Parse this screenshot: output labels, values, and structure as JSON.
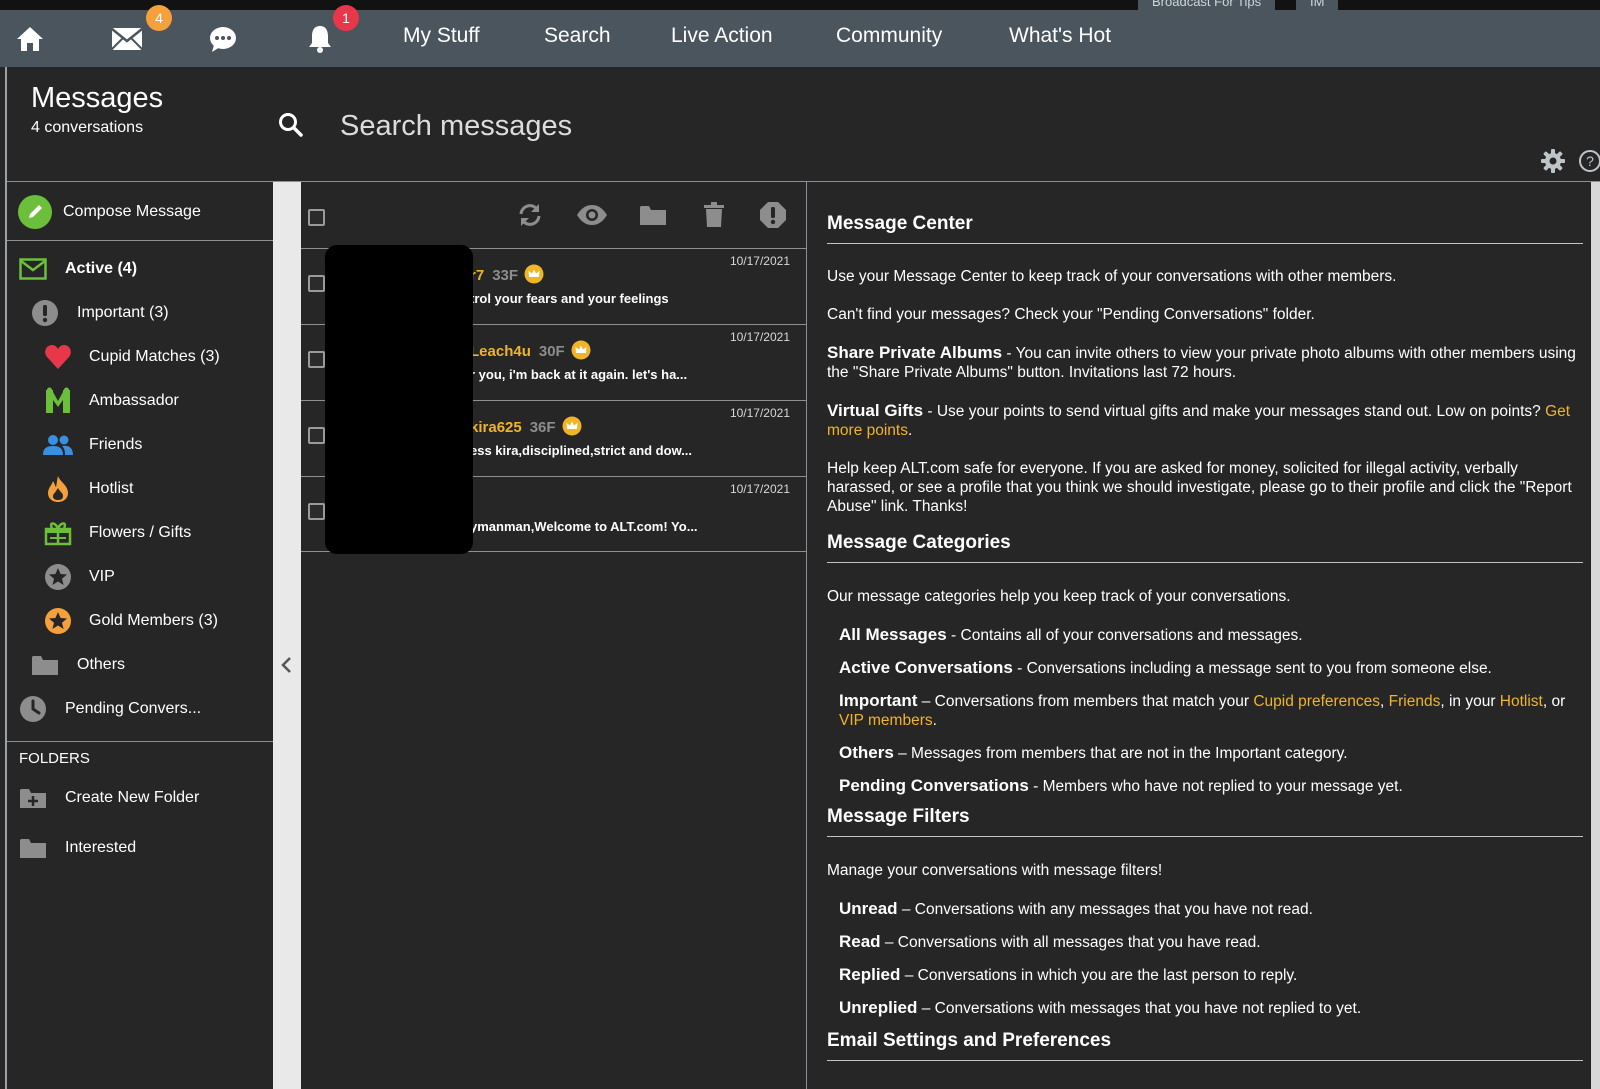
{
  "topstrip": {
    "tabs": [
      "Broadcast For Tips",
      "IM"
    ]
  },
  "nav": {
    "mail_badge": "4",
    "notif_badge": "1",
    "links": [
      "My Stuff",
      "Search",
      "Live Action",
      "Community",
      "What's Hot"
    ]
  },
  "header": {
    "title": "Messages",
    "subtitle": "4 conversations",
    "search_placeholder": "Search messages"
  },
  "sidebar": {
    "compose": "Compose Message",
    "items": [
      {
        "label": "Active (4)",
        "icon": "envelope-icon"
      },
      {
        "label": "Important (3)",
        "icon": "exclamation-icon"
      },
      {
        "label": "Cupid Matches (3)",
        "icon": "heart-icon"
      },
      {
        "label": "Ambassador",
        "icon": "ambassador-icon"
      },
      {
        "label": "Friends",
        "icon": "friends-icon"
      },
      {
        "label": "Hotlist",
        "icon": "flame-icon"
      },
      {
        "label": "Flowers / Gifts",
        "icon": "gift-icon"
      },
      {
        "label": "VIP",
        "icon": "star-icon"
      },
      {
        "label": "Gold Members (3)",
        "icon": "gold-star-icon"
      },
      {
        "label": "Others",
        "icon": "folder-icon"
      },
      {
        "label": "Pending Convers...",
        "icon": "clock-icon"
      }
    ],
    "folders_heading": "FOLDERS",
    "create_folder": "Create New Folder",
    "folders": [
      "Interested"
    ]
  },
  "messages": [
    {
      "name": "r7",
      "age": "33F",
      "snippet": "trol your fears and your feelings",
      "date": "10/17/2021"
    },
    {
      "name": "Leach4u",
      "age": "30F",
      "snippet": "r you, i'm back at it again. let's ha...",
      "date": "10/17/2021"
    },
    {
      "name": "kira625",
      "age": "36F",
      "snippet": "ess kira,disciplined,strict and dow...",
      "date": "10/17/2021"
    },
    {
      "name": "",
      "age": "",
      "snippet": "ymanman,Welcome to ALT.com! Yo...",
      "date": "10/17/2021"
    }
  ],
  "info": {
    "h1": "Message Center",
    "p1": "Use your Message Center to keep track of your conversations with other members.",
    "p2": "Can't find your messages? Check your \"Pending Conversations\" folder.",
    "share_title": "Share Private Albums",
    "share_text": " - You can invite others to view your private photo albums with other members using the \"Share Private Albums\" button. Invitations last 72 hours.",
    "gifts_title": "Virtual Gifts",
    "gifts_text": " - Use your points to send virtual gifts and make your messages stand out. Low on points? ",
    "gifts_link": "Get more points",
    "safety": "Help keep ALT.com safe for everyone. If you are asked for money, solicited for illegal activity, verbally harassed, or see a profile that you think we should investigate, please go to their profile and click the \"Report Abuse\" link. Thanks!",
    "h2": "Message Categories",
    "cat_intro": "Our message categories help you keep track of your conversations.",
    "cat_all_title": "All Messages",
    "cat_all_text": " - Contains all of your conversations and messages.",
    "cat_active_title": "Active Conversations",
    "cat_active_text": " - Conversations including a message sent to you from someone else.",
    "cat_imp_title": "Important",
    "cat_imp_text1": " – Conversations from members that match your ",
    "cat_imp_link1": "Cupid preferences",
    "cat_imp_sep1": ", ",
    "cat_imp_link2": "Friends",
    "cat_imp_text2": ", in your ",
    "cat_imp_link3": "Hotlist",
    "cat_imp_text3": ", or ",
    "cat_imp_link4": "VIP members",
    "cat_imp_end": ".",
    "cat_others_title": "Others",
    "cat_others_text": " – Messages from members that are not in the Important category.",
    "cat_pending_title": "Pending Conversations",
    "cat_pending_text": " - Members who have not replied to your message yet.",
    "h3": "Message Filters",
    "filter_intro": "Manage your conversations with message filters!",
    "f_unread_title": "Unread",
    "f_unread_text": " – Conversations with any messages that you have not read.",
    "f_read_title": "Read",
    "f_read_text": " – Conversations with all messages that you have read.",
    "f_replied_title": "Replied",
    "f_replied_text": " – Conversations in which you are the last person to reply.",
    "f_unreplied_title": "Unreplied",
    "f_unreplied_text": " – Conversations with messages that you have not replied to yet.",
    "h4": "Email Settings and Preferences"
  },
  "colors": {
    "nav": "#4a555d",
    "bg": "#262626",
    "accent": "#f0b429",
    "badge_orange": "#f5a03c",
    "badge_red": "#e8374b",
    "compose_green": "#6cbf3a"
  }
}
